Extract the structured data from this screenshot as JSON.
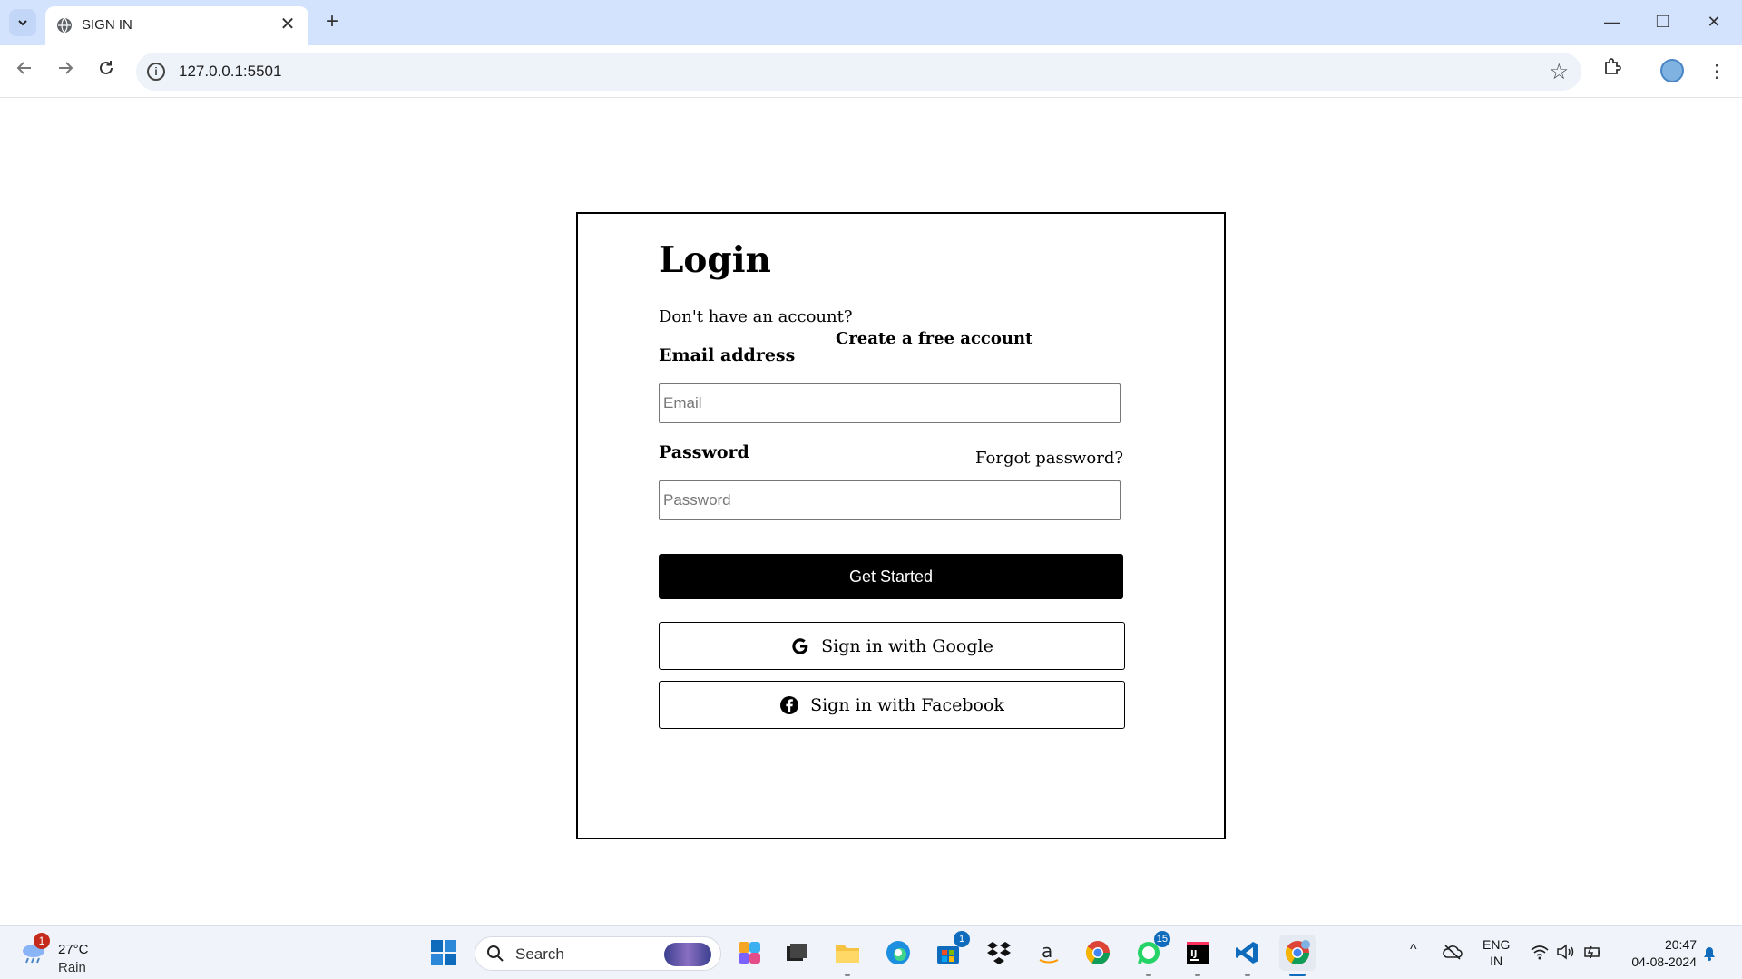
{
  "browser": {
    "tab_title": "SIGN IN",
    "url": "127.0.0.1:5501"
  },
  "login": {
    "title": "Login",
    "no_account_text": "Don't have an account?",
    "create_account_link": "Create a free account",
    "email_label": "Email address",
    "email_placeholder": "Email",
    "email_value": "",
    "password_label": "Password",
    "forgot_password_link": "Forgot password?",
    "password_placeholder": "Password",
    "password_value": "",
    "submit_label": "Get Started",
    "google_label": "Sign in with Google",
    "facebook_label": "Sign in with Facebook"
  },
  "taskbar": {
    "weather_temp": "27°C",
    "weather_condition": "Rain",
    "weather_badge": "1",
    "search_label": "Search",
    "store_badge": "1",
    "whatsapp_badge": "15",
    "lang_line1": "ENG",
    "lang_line2": "IN",
    "time": "20:47",
    "date": "04-08-2024"
  },
  "colors": {
    "tabbar_bg": "#d3e3fd",
    "primary_button_bg": "#000000",
    "taskbar_bg": "#f0f3f9",
    "badge_red": "#c42b1c",
    "badge_blue": "#0f6cbd"
  }
}
